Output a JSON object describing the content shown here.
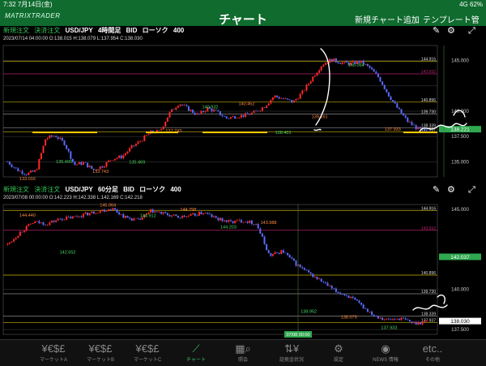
{
  "status": {
    "time": "7:32",
    "date": "7月14日(金)",
    "signal": "4G 62%"
  },
  "header": {
    "logo": "MATRIXTRADER",
    "title": "チャート",
    "add_chart": "新規チャート追加",
    "template": "テンプレート管理"
  },
  "panels": [
    {
      "new_order": "新規注文",
      "settle_order": "決済注文",
      "pair": "USD/JPY",
      "timeframe": "4時間足",
      "side": "BID",
      "chart_type": "ローソク",
      "count": "400",
      "ohlc": "2023/07/14 04:00:00   O:138.015  H:138.079  L:137.954  C:138.030"
    },
    {
      "new_order": "新規注文",
      "settle_order": "決済注文",
      "pair": "USD/JPY",
      "timeframe": "60分足",
      "side": "BID",
      "chart_type": "ローソク",
      "count": "400",
      "ohlc": "2023/07/08 00:00:00   O:142.223  H:142.338  L:142.169  C:142.218",
      "crosshair_time": "07/08 00:00"
    }
  ],
  "chart_data": [
    {
      "type": "candlestick",
      "title": "USD/JPY 4時間足",
      "ylim": [
        133.5,
        146.5
      ],
      "y_ticks": [
        135.0,
        137.5,
        140.0,
        142.5,
        145.0
      ],
      "y_tick_labels": [
        "135.000",
        "137.500",
        "140.000",
        "",
        "145.000"
      ],
      "current_price": "138.221",
      "price_path": [
        135.0,
        134.2,
        133.8,
        134.1,
        137.3,
        137.6,
        136.8,
        134.7,
        134.9,
        134.2,
        134.6,
        135.3,
        135.5,
        136.4,
        137.1,
        137.9,
        138.0,
        139.8,
        140.8,
        140.2,
        139.6,
        140.3,
        139.9,
        139.3,
        139.5,
        139.6,
        139.9,
        140.5,
        141.5,
        141.2,
        140.9,
        141.9,
        143.3,
        144.6,
        145.1,
        144.8,
        144.7,
        144.9,
        144.3,
        143.3,
        141.6,
        140.2,
        139.0,
        138.3,
        137.9
      ],
      "annotations": [
        "133.016",
        "135.499",
        "133.743",
        "135.469",
        "137.743",
        "140.932",
        "140.452",
        "138.401",
        "139.161",
        "145.064",
        "137.933"
      ],
      "right_labels": [
        "144.916",
        "143.692",
        "140.896",
        "139.730",
        "138.339",
        "137.937"
      ]
    },
    {
      "type": "candlestick",
      "title": "USD/JPY 60分足",
      "ylim": [
        137.2,
        145.3
      ],
      "y_ticks": [
        137.5,
        140.0,
        145.0
      ],
      "y_tick_labels": [
        "137.500",
        "140.000",
        "145.000"
      ],
      "current_price": "142.037",
      "last_price": "138.030",
      "price_path": [
        142.8,
        143.6,
        144.2,
        144.1,
        144.4,
        144.5,
        144.7,
        144.9,
        145.05,
        144.5,
        144.3,
        144.9,
        144.7,
        144.5,
        144.6,
        144.8,
        144.4,
        144.2,
        144.3,
        144.1,
        142.1,
        142.4,
        141.6,
        141.0,
        140.5,
        139.9,
        139.6,
        139.0,
        138.4,
        138.1,
        138.2,
        137.9,
        138.0
      ],
      "annotations": [
        "144.440",
        "142.652",
        "145.064",
        "144.912",
        "144.798",
        "144.203",
        "143.988",
        "138.952",
        "138.079",
        "137.933"
      ],
      "right_labels": [
        "144.916",
        "143.692",
        "140.896",
        "139.730",
        "138.339",
        "137.937"
      ]
    }
  ],
  "tabs": [
    {
      "icon": "¥€$£",
      "label": "マーケットA"
    },
    {
      "icon": "¥€$£",
      "label": "マーケットB"
    },
    {
      "icon": "¥€$£",
      "label": "マーケットC"
    },
    {
      "icon": "⟋",
      "label": "チャート"
    },
    {
      "icon": "▦⌕",
      "label": "照会"
    },
    {
      "icon": "⇅¥",
      "label": "証拠金状況"
    },
    {
      "icon": "⚙",
      "label": "設定"
    },
    {
      "icon": "◉",
      "label": "NEWS 情報"
    },
    {
      "icon": "etc..",
      "label": "その他"
    }
  ],
  "colors": {
    "green_header": "#0f6b2e",
    "up": "#ff2a2a",
    "down": "#5a6cff",
    "level_yellow": "#c8b400",
    "level_magenta": "#b0206a",
    "active_tab": "#3ac06a"
  }
}
